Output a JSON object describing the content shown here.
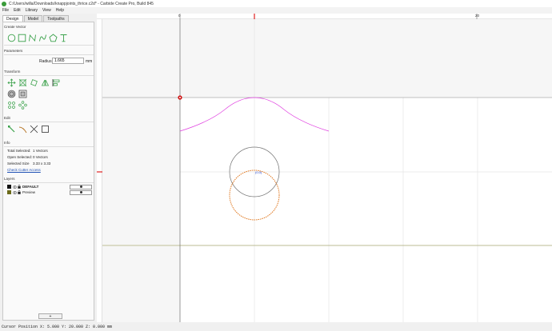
{
  "window": {
    "title": "C:/Users/willa/Downloads/knappjoints_thrice.c2d* - Carbide Create Pro, Build 845"
  },
  "menu": [
    "File",
    "Edit",
    "Library",
    "View",
    "Help"
  ],
  "tabs": [
    {
      "label": "Design",
      "active": true
    },
    {
      "label": "Model",
      "active": false
    },
    {
      "label": "Toolpaths",
      "active": false
    }
  ],
  "sections": {
    "create_vector": "Create Vector",
    "parameters": "Parameters",
    "transform": "Transform",
    "edit": "Edit",
    "info": "Info",
    "layers": "Layers"
  },
  "parameters": {
    "radius_label": "Radius",
    "radius_value": "1.665",
    "unit": "mm"
  },
  "info": {
    "total_selected_label": "Total Selected:",
    "total_selected_value": "1 Vectors",
    "open_selected_label": "Open Selected:",
    "open_selected_value": "0 Vectors",
    "selected_size_label": "Selected Size",
    "selected_size_value": "3.33 x 3.33",
    "check_link": "Check Cutter Access"
  },
  "layers": [
    {
      "name": "DEFAULT",
      "color": "#111111",
      "bold": true
    },
    {
      "name": "Preview",
      "color": "#6b6a1a",
      "bold": false
    }
  ],
  "add_layer_label": "+",
  "ruler": {
    "left_label": "0",
    "right_label": "20"
  },
  "canvas": {
    "origin_label": "(0,0)"
  },
  "colors": {
    "icon_green": "#3aa14a",
    "arc_magenta": "#e040e0",
    "circle_orange": "#e07820",
    "circle_gray": "#707070",
    "grid_line": "#dcdcdc",
    "origin_red": "#d01010"
  },
  "status": {
    "cursor_position": "Cursor Position X: 5.000 Y: 20.000 Z: 0.000 mm"
  }
}
